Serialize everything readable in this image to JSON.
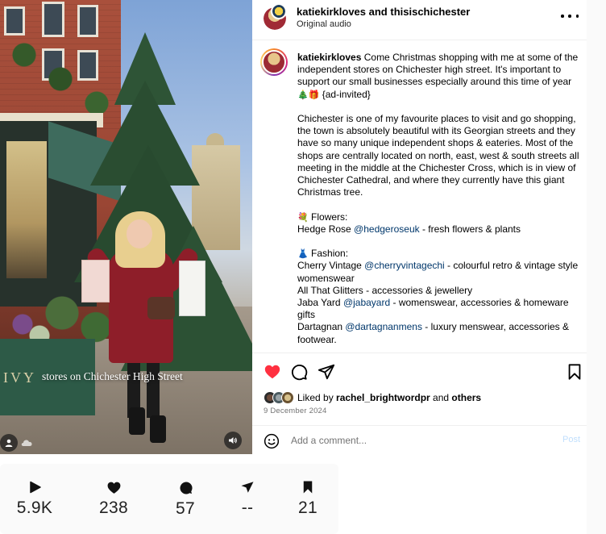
{
  "media": {
    "overlay_caption": "stores on Chichester High Street",
    "planter_sign": "IVY",
    "tag_button_icon": "person-tag-icon",
    "sound_button_icon": "speaker-icon"
  },
  "post": {
    "header": {
      "author": "katiekirkloves",
      "connector": " and ",
      "collaborator": "thisischichester",
      "audio": "Original audio",
      "more_icon": "more-horizontal-icon"
    },
    "caption": {
      "username": "katiekirkloves",
      "intro": " Come Christmas shopping with me at some of the independent stores on Chichester high street. It's important to support our small businesses especially around this time of year ",
      "intro_emoji": "🎄🎁",
      "intro_tail": " {ad-invited}",
      "paragraph2": "Chichester is one of my favourite places to visit and go shopping, the town is absolutely beautiful with its Georgian streets and they have so many unique independent shops & eateries. Most of the shops are centrally located on north, east, west & south streets all meeting in the middle at the Chichester Cross, which is in view of Chichester Cathedral, and where they currently have this giant Christmas tree.",
      "flowers_emoji": "💐",
      "flowers_heading": " Flowers:",
      "flowers_item_name": "Hedge Rose ",
      "flowers_item_handle": "@hedgeroseuk",
      "flowers_item_desc": " - fresh flowers & plants",
      "fashion_emoji": "👗",
      "fashion_heading": " Fashion:",
      "fashion_items": [
        {
          "name": "Cherry Vintage ",
          "handle": "@cherryvintagechi",
          "desc": " - colourful retro & vintage style womenswear"
        },
        {
          "name": "All That Glitters - accessories & jewellery",
          "handle": "",
          "desc": ""
        },
        {
          "name": "Jaba Yard ",
          "handle": "@jabayard",
          "desc": " - womenswear, accessories & homeware gifts"
        },
        {
          "name": "Dartagnan ",
          "handle": "@dartagnanmens",
          "desc": " - luxury menswear, accessories & footwear."
        }
      ]
    },
    "actions": {
      "liked": true,
      "heart_color": "#ff3040",
      "liked_by_prefix": "Liked by ",
      "liked_by_user": "rachel_brightwordpr",
      "liked_by_mid": " and ",
      "liked_by_suffix": "others",
      "date": "9 December 2024"
    },
    "comment": {
      "placeholder": "Add a comment...",
      "post_label": "Post",
      "emoji_icon": "smiley-icon"
    }
  },
  "stats": {
    "plays": "5.9K",
    "likes": "238",
    "comments": "57",
    "shares": "--",
    "saves": "21"
  }
}
